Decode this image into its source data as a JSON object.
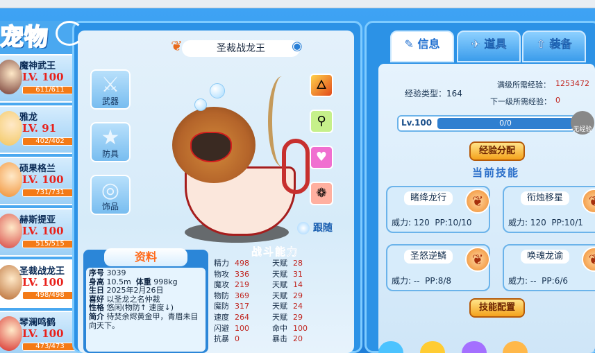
{
  "logo": {
    "text": "宠物"
  },
  "pets": [
    {
      "name": "魔神武王",
      "level": "LV. 100",
      "hp": "611/611",
      "hp_fraction": 1.0,
      "color": "#6b2f2a"
    },
    {
      "name": "雅龙",
      "level": "LV. 91",
      "hp": "402/402",
      "hp_fraction": 1.0,
      "color": "#f1c55a"
    },
    {
      "name": "硕果格兰",
      "level": "LV. 100",
      "hp": "731/731",
      "hp_fraction": 1.0,
      "color": "#f08a2a"
    },
    {
      "name": "赫斯提亚",
      "level": "LV. 100",
      "hp": "515/515",
      "hp_fraction": 1.0,
      "color": "#d43a3a"
    },
    {
      "name": "圣裁战龙王",
      "level": "LV. 100",
      "hp": "498/498",
      "hp_fraction": 1.0,
      "color": "#b4642a",
      "selected": true
    },
    {
      "name": "琴澜鸣鹤",
      "level": "LV. 100",
      "hp": "473/473",
      "hp_fraction": 1.0,
      "color": "#d52424"
    }
  ],
  "pet": {
    "name": "圣裁战龙王",
    "equip": [
      {
        "label": "武器",
        "icon": "sword-icon"
      },
      {
        "label": "防具",
        "icon": "star-shield-icon"
      },
      {
        "label": "饰品",
        "icon": "ring-icon"
      }
    ],
    "follow_label": "跟随"
  },
  "info": {
    "title": "资料",
    "id_label": "序号",
    "id": "3039",
    "height_label": "身高",
    "height": "10.5m",
    "weight_label": "体重",
    "weight": "998kg",
    "birthday_label": "生日",
    "birthday": "2025年2月26日",
    "hobby_label": "喜好",
    "hobby": "以圣龙之名仲裁",
    "nature_label": "性格",
    "nature": "悠闲(物防↑ 速度↓)",
    "intro_label": "简介",
    "intro": "待焚余烬黄金甲，青眉未目向天下。"
  },
  "stats": {
    "title": "战斗能力",
    "rows": [
      {
        "k1": "精力",
        "v1": "498",
        "k2": "天赋",
        "v2": "28"
      },
      {
        "k1": "物攻",
        "v1": "336",
        "k2": "天赋",
        "v2": "31"
      },
      {
        "k1": "魔攻",
        "v1": "219",
        "k2": "天赋",
        "v2": "14"
      },
      {
        "k1": "物防",
        "v1": "369",
        "k2": "天赋",
        "v2": "29"
      },
      {
        "k1": "魔防",
        "v1": "317",
        "k2": "天赋",
        "v2": "24"
      },
      {
        "k1": "速度",
        "v1": "264",
        "k2": "天赋",
        "v2": "29"
      },
      {
        "k1": "闪避",
        "v1": "100",
        "k2": "命中",
        "v2": "100"
      },
      {
        "k1": "抗暴",
        "v1": "0",
        "k2": "暴击",
        "v2": "20"
      }
    ]
  },
  "tabs": [
    {
      "label": "信息",
      "icon": "info-icon"
    },
    {
      "label": "道具",
      "icon": "item-icon"
    },
    {
      "label": "装备",
      "icon": "equip-icon"
    }
  ],
  "exp": {
    "type_label": "经验类型：",
    "type_value": "164",
    "full_label": "满级所需经验：",
    "full_value": "1253472",
    "next_label": "下一级所需经验：",
    "next_value": "0",
    "level": "Lv.100",
    "bar_text": "0/0",
    "unbind_label": "无经验",
    "distribute_label": "经验分配"
  },
  "skills": {
    "title": "当前技能",
    "items": [
      {
        "name": "睹绛龙行",
        "power": "威力: 120",
        "pp": "PP:10/10"
      },
      {
        "name": "衔烛移星",
        "power": "威力: 120",
        "pp": "PP:10/1"
      },
      {
        "name": "圣怒逆鳞",
        "power": "威力: --",
        "pp": "PP:8/8"
      },
      {
        "name": "唤魂龙谕",
        "power": "威力: --",
        "pp": "PP:6/6"
      }
    ],
    "config_label": "技能配置"
  }
}
